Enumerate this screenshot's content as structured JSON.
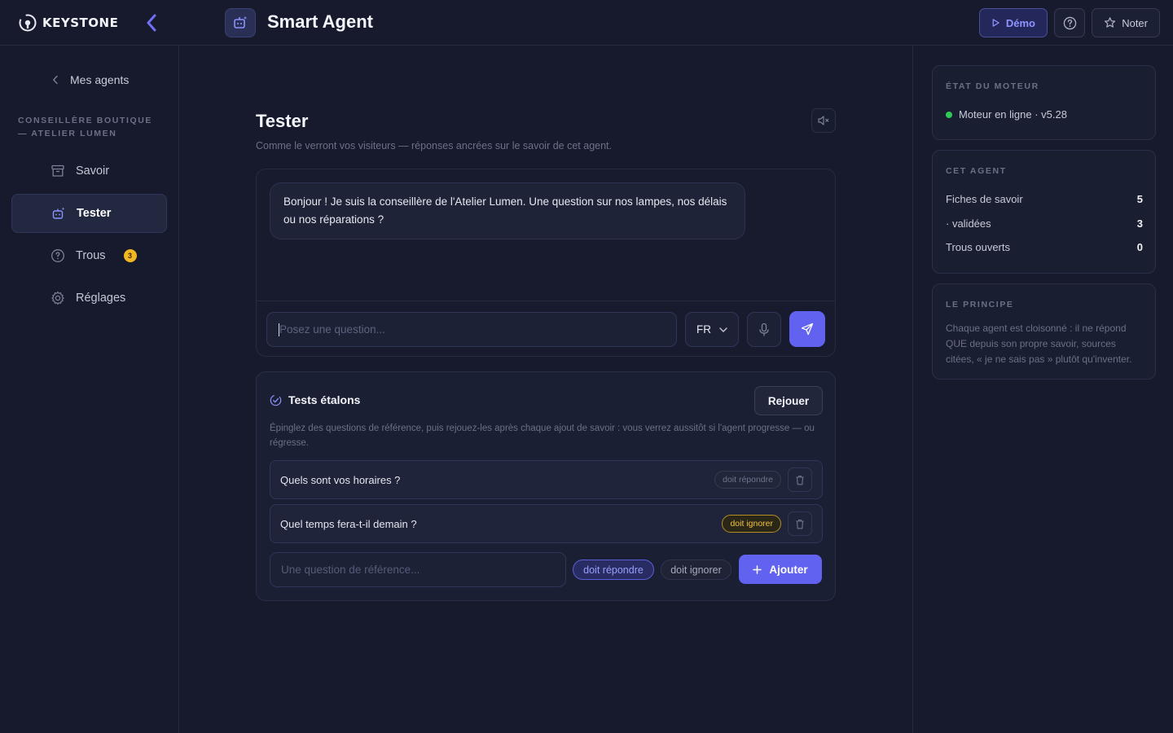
{
  "brand": {
    "name": "KEYSTONE"
  },
  "header": {
    "title": "Smart Agent",
    "demo_label": "Démo",
    "rate_label": "Noter"
  },
  "sidebar": {
    "back_label": "Mes agents",
    "agent_name": "CONSEILLÈRE BOUTIQUE — ATELIER LUMEN",
    "items": [
      {
        "label": "Savoir",
        "icon": "archive-icon",
        "active": false
      },
      {
        "label": "Tester",
        "icon": "robot-icon",
        "active": true
      },
      {
        "label": "Trous",
        "icon": "question-circle-icon",
        "badge": "3",
        "active": false
      },
      {
        "label": "Réglages",
        "icon": "gear-icon",
        "active": false
      }
    ]
  },
  "main": {
    "title": "Tester",
    "subtitle": "Comme le verront vos visiteurs — réponses ancrées sur le savoir de cet agent.",
    "chat": {
      "greeting": "Bonjour ! Je suis la conseillère de l'Atelier Lumen. Une question sur nos lampes, nos délais ou nos réparations ?",
      "input_placeholder": "Posez une question...",
      "language": "FR"
    },
    "tests": {
      "title": "Tests étalons",
      "replay_label": "Rejouer",
      "description": "Épinglez des questions de référence, puis rejouez-les après chaque ajout de savoir : vous verrez aussitôt si l'agent progresse — ou régresse.",
      "rows": [
        {
          "question": "Quels sont vos horaires ?",
          "expectation": "doit répondre"
        },
        {
          "question": "Quel temps fera-t-il demain ?",
          "expectation": "doit ignorer"
        }
      ],
      "new_placeholder": "Une question de référence...",
      "option_answer": "doit répondre",
      "option_ignore": "doit ignorer",
      "add_label": "Ajouter"
    }
  },
  "right": {
    "engine": {
      "label": "ÉTAT DU MOTEUR",
      "status": "Moteur en ligne · v5.28",
      "status_color": "#2ecc55"
    },
    "agent": {
      "label": "CET AGENT",
      "stats": [
        {
          "name": "Fiches de savoir",
          "value": "5"
        },
        {
          "name": "· validées",
          "value": "3"
        },
        {
          "name": "Trous ouverts",
          "value": "0"
        }
      ]
    },
    "principle": {
      "label": "LE PRINCIPE",
      "text": "Chaque agent est cloisonné : il ne répond QUE depuis son propre savoir, sources citées, « je ne sais pas » plutôt qu'inventer."
    }
  },
  "colors": {
    "accent": "#6262f0",
    "warning": "#f0c43a",
    "background": "#161a2c"
  }
}
